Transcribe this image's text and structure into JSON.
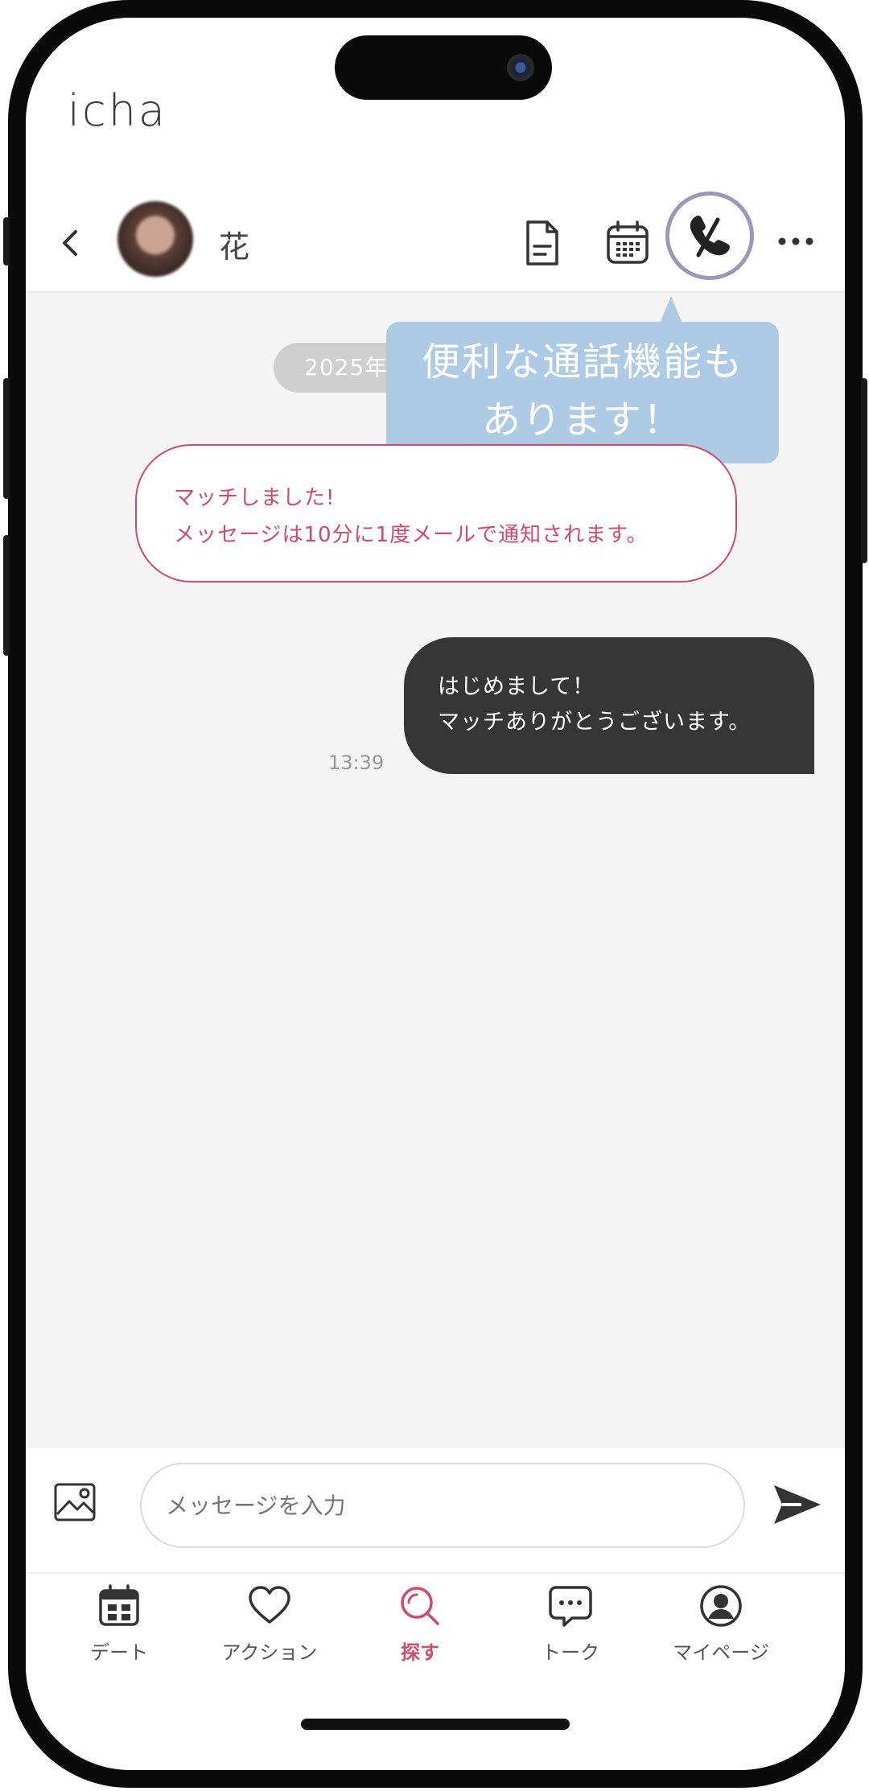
{
  "app": {
    "logo": "icha"
  },
  "header": {
    "user_name": "花",
    "icons": [
      "back-icon",
      "document-icon",
      "calendar-icon",
      "phone-icon",
      "more-icon"
    ]
  },
  "chat": {
    "date_label": "2025年",
    "tooltip": [
      "便利な通話機能も",
      "あります！"
    ],
    "match_notice": [
      "マッチしました!",
      "メッセージは10分に1度メールで通知されます。"
    ],
    "messages": [
      {
        "lines": [
          "はじめまして！",
          "マッチありがとうございます。"
        ],
        "time": "13:39",
        "from": "me"
      }
    ]
  },
  "composer": {
    "placeholder": "メッセージを入力",
    "icons": [
      "image-icon",
      "send-icon"
    ]
  },
  "tabs": [
    {
      "label": "デート",
      "icon": "calendar-icon",
      "active": false
    },
    {
      "label": "アクション",
      "icon": "heart-icon",
      "active": false
    },
    {
      "label": "探す",
      "icon": "search-icon",
      "active": true
    },
    {
      "label": "トーク",
      "icon": "chat-icon",
      "active": false
    },
    {
      "label": "マイページ",
      "icon": "profile-icon",
      "active": false
    }
  ],
  "colors": {
    "accent": "#d24a6b",
    "tooltip": "#aecbe6",
    "bubble": "#363636",
    "chat_bg": "#f4f4f4"
  }
}
